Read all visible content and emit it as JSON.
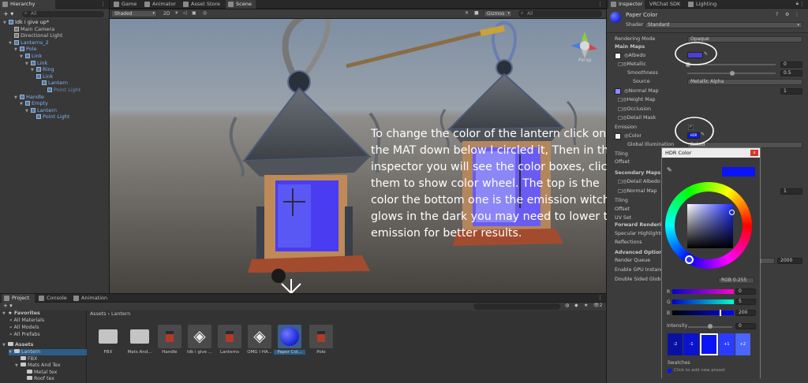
{
  "hierarchy": {
    "tab": "Hierarchy",
    "search_placeholder": "All",
    "items": [
      {
        "label": "Idk i give up*",
        "depth": 0,
        "type": "scene"
      },
      {
        "label": "Main Camera",
        "depth": 1,
        "type": "go"
      },
      {
        "label": "Directional Light",
        "depth": 1,
        "type": "go"
      },
      {
        "label": "Lanterns_2",
        "depth": 1,
        "type": "prefab"
      },
      {
        "label": "Pole",
        "depth": 2,
        "type": "prefab"
      },
      {
        "label": "Link",
        "depth": 3,
        "type": "prefab"
      },
      {
        "label": "Link",
        "depth": 4,
        "type": "prefab"
      },
      {
        "label": "Ring",
        "depth": 5,
        "type": "prefab"
      },
      {
        "label": "Link",
        "depth": 5,
        "type": "prefab"
      },
      {
        "label": "Lantern",
        "depth": 6,
        "type": "prefab"
      },
      {
        "label": "Point Light",
        "depth": 7,
        "type": "light-dim"
      },
      {
        "label": "Handle",
        "depth": 2,
        "type": "prefab"
      },
      {
        "label": "Empty",
        "depth": 3,
        "type": "prefab"
      },
      {
        "label": "Lantern",
        "depth": 4,
        "type": "prefab"
      },
      {
        "label": "Point Light",
        "depth": 5,
        "type": "light"
      }
    ]
  },
  "scene_tabs": {
    "game": "Game",
    "animator": "Animator",
    "asset_store": "Asset Store",
    "scene": "Scene"
  },
  "scene_toolbar": {
    "shading": "Shaded",
    "mode_2d": "2D",
    "gizmos": "Gizmos",
    "search_placeholder": "All"
  },
  "scene_view": {
    "persp_label": "Persp"
  },
  "annotation_text": "To change the color of the lantern click on the MAT down below I circled it, Then in the inspector you will see the color boxes, click them to show color wheel. The top is the color the bottom one is the emission witch glows in the dark you may need to lower the emission for better results.",
  "inspector": {
    "tabs": {
      "inspector": "Inspector",
      "vrchat": "VRChat SDK",
      "lighting": "Lighting"
    },
    "material_name": "Paper Color",
    "shader_label": "Shader",
    "shader_value": "Standard",
    "rendering_mode_label": "Rendering Mode",
    "rendering_mode_value": "Opaque",
    "main_maps": "Main Maps",
    "albedo": "Albedo",
    "metallic": "Metallic",
    "metallic_value": "0",
    "smoothness": "Smoothness",
    "smoothness_value": "0.5",
    "source": "Source",
    "source_value": "Metallic Alpha",
    "normal_map": "Normal Map",
    "normal_map_value": "1",
    "height_map": "Height Map",
    "occlusion": "Occlusion",
    "detail_mask": "Detail Mask",
    "emission": "Emission",
    "emission_color": "Color",
    "global_illumination": "Global Illumination",
    "global_illumination_value": "Baked",
    "tiling": "Tiling",
    "offset": "Offset",
    "secondary_maps": "Secondary Maps",
    "detail_albedo": "Detail Albedo x2",
    "normal_map_2": "Normal Map",
    "normal_map_2_value": "1",
    "tiling_2": "Tiling",
    "offset_2": "Offset",
    "uv_set": "UV Set",
    "forward_rendering": "Forward Rendering",
    "specular_highlights": "Specular Highlights",
    "reflections": "Reflections",
    "advanced_options": "Advanced Options",
    "render_queue": "Render Queue",
    "render_queue_mode": "From Shader",
    "render_queue_value": "2000",
    "gpu_instancing": "Enable GPU Instancing",
    "double_sided": "Double Sided Global Illumination"
  },
  "hdr": {
    "title": "HDR Color",
    "mode": "RGB 0-255",
    "r_label": "R",
    "r_value": "0",
    "g_label": "G",
    "g_value": "5",
    "b_label": "B",
    "b_value": "200",
    "intensity_label": "Intensity",
    "intensity_value": "0",
    "stops": [
      "-2",
      "-1",
      "",
      "+1",
      "+2"
    ],
    "swatches_label": "Swatches",
    "swatches_hint": "Click to add new preset",
    "current_color": "#0005C8"
  },
  "project": {
    "tabs": {
      "project": "Project",
      "console": "Console",
      "animation": "Animation"
    },
    "breadcrumb": [
      "Assets",
      "Lantern"
    ],
    "favorites": "Favorites",
    "fav_items": [
      "All Materials",
      "All Models",
      "All Prefabs"
    ],
    "assets_root": "Assets",
    "tree": [
      {
        "label": "Lantern",
        "depth": 1
      },
      {
        "label": "FBX",
        "depth": 2
      },
      {
        "label": "Mats And Tex",
        "depth": 2
      },
      {
        "label": "Metal tex",
        "depth": 3
      },
      {
        "label": "Roof tex",
        "depth": 3
      }
    ],
    "assets": [
      {
        "label": "FBX",
        "kind": "folder"
      },
      {
        "label": "Mats And...",
        "kind": "folder"
      },
      {
        "label": "Handle",
        "kind": "prefab"
      },
      {
        "label": "Idk i give ...",
        "kind": "unity"
      },
      {
        "label": "Lanterns",
        "kind": "prefab"
      },
      {
        "label": "OMG I HA...",
        "kind": "unity"
      },
      {
        "label": "Paper Col...",
        "kind": "material"
      },
      {
        "label": "Pole",
        "kind": "prefab"
      }
    ],
    "count_badge": "2"
  }
}
